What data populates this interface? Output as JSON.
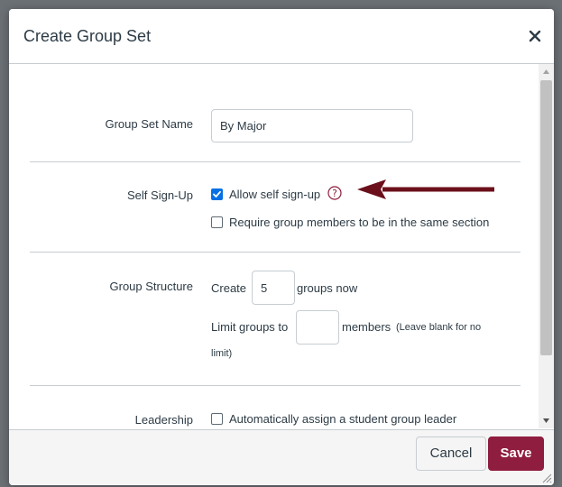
{
  "dialog": {
    "title": "Create Group Set",
    "close_icon": "close-icon"
  },
  "form": {
    "name_section": {
      "label": "Group Set Name",
      "value": "By Major"
    },
    "self_signup_section": {
      "label": "Self Sign-Up",
      "allow_label": "Allow self sign-up",
      "allow_checked": true,
      "help_icon": "question-circle-icon",
      "require_section_label": "Require group members to be in the same section",
      "require_section_checked": false
    },
    "structure_section": {
      "label": "Group Structure",
      "create_prefix": "Create",
      "group_count": "5",
      "create_suffix": "groups now",
      "limit_prefix": "Limit groups to",
      "limit_value": "",
      "limit_suffix": "members",
      "limit_hint_1": "(Leave blank for no",
      "limit_hint_2": "limit)"
    },
    "leadership_section": {
      "label": "Leadership",
      "auto_assign_label": "Automatically assign a student group leader",
      "auto_assign_checked": false
    }
  },
  "footer": {
    "cancel_label": "Cancel",
    "save_label": "Save"
  },
  "annotation": {
    "arrow_icon": "arrow-left-icon",
    "arrow_color": "#6b0f1a"
  },
  "colors": {
    "save_bg": "#8f1d3f",
    "checkbox_on": "#0770e3",
    "help_icon": "#8f1d3f"
  }
}
